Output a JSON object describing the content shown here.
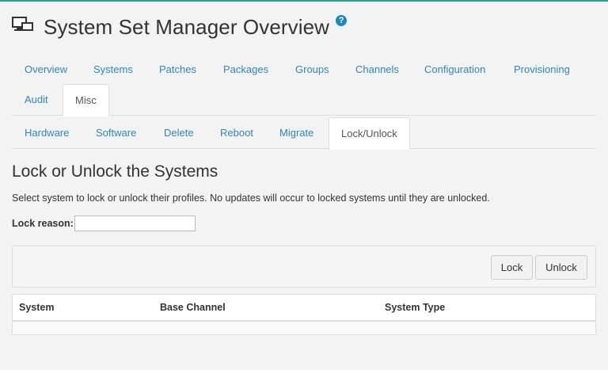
{
  "header": {
    "title": "System Set Manager Overview",
    "help_glyph": "?"
  },
  "tabs_row1": [
    "Overview",
    "Systems",
    "Patches",
    "Packages",
    "Groups",
    "Channels",
    "Configuration",
    "Provisioning"
  ],
  "tabs_row2": [
    "Audit",
    "Misc"
  ],
  "tabs_row3": [
    "Hardware",
    "Software",
    "Delete",
    "Reboot",
    "Migrate",
    "Lock/Unlock"
  ],
  "active_tabs": {
    "row2": "Misc",
    "row3": "Lock/Unlock"
  },
  "section": {
    "title": "Lock or Unlock the Systems",
    "description": "Select system to lock or unlock their profiles. No updates will occur to locked systems until they are unlocked.",
    "lock_reason_label": "Lock reason:",
    "lock_reason_value": ""
  },
  "buttons": {
    "lock": "Lock",
    "unlock": "Unlock"
  },
  "table": {
    "headers": [
      "System",
      "Base Channel",
      "System Type"
    ],
    "rows": []
  },
  "colors": {
    "accent": "#2aa38c",
    "link": "#2e87b8",
    "help": "#1a87c7"
  }
}
